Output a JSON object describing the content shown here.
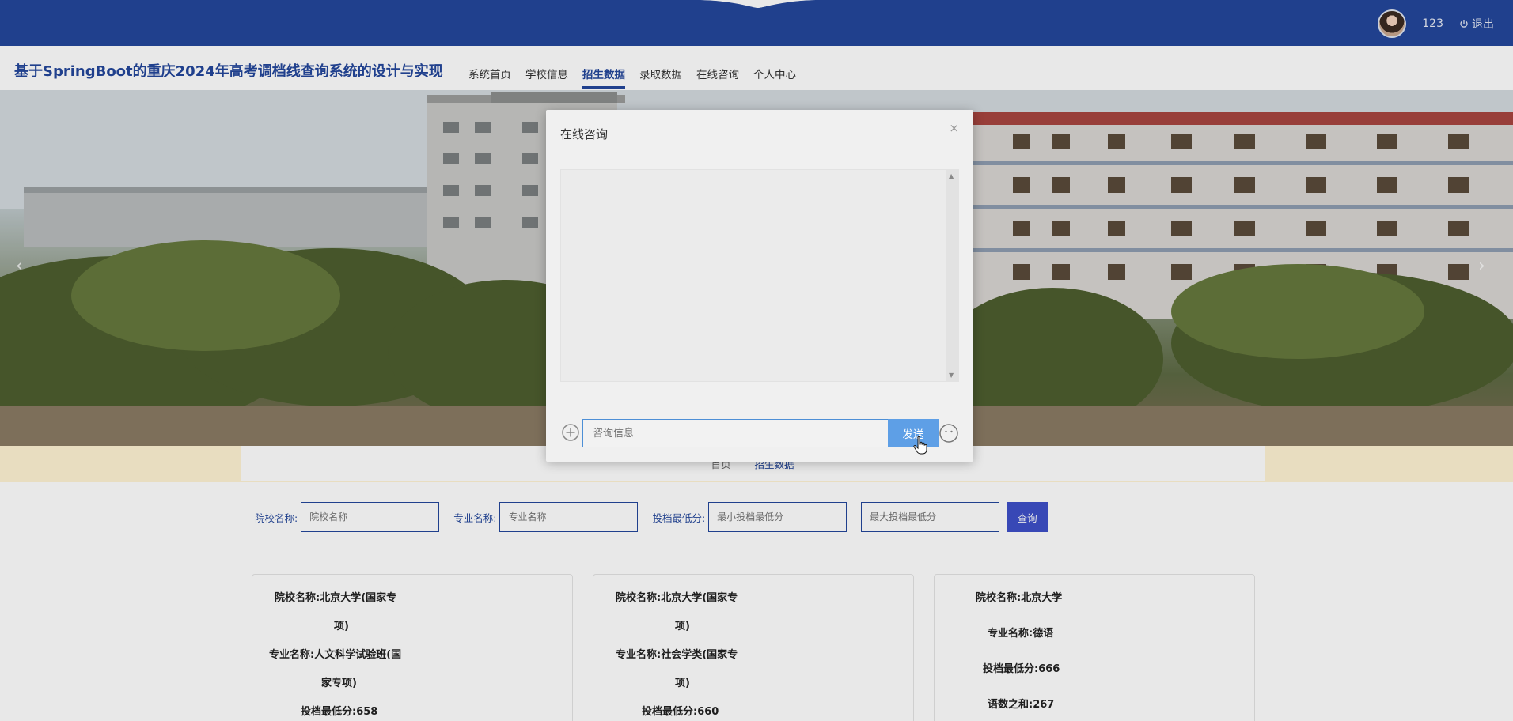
{
  "topbar": {
    "username": "123",
    "logout_label": "退出"
  },
  "header": {
    "site_title": "基于SpringBoot的重庆2024年高考调档线查询系统的设计与实现",
    "nav": [
      {
        "label": "系统首页",
        "active": false
      },
      {
        "label": "学校信息",
        "active": false
      },
      {
        "label": "招生数据",
        "active": true
      },
      {
        "label": "录取数据",
        "active": false
      },
      {
        "label": "在线咨询",
        "active": false
      },
      {
        "label": "个人中心",
        "active": false
      }
    ]
  },
  "breadcrumb": {
    "home": "首页",
    "current": "招生数据"
  },
  "search": {
    "school_label": "院校名称:",
    "school_placeholder": "院校名称",
    "major_label": "专业名称:",
    "major_placeholder": "专业名称",
    "score_label": "投档最低分:",
    "min_placeholder": "最小投档最低分",
    "max_placeholder": "最大投档最低分",
    "button": "查询"
  },
  "cards": [
    {
      "lines": [
        "院校名称:北京大学(国家专",
        "项)",
        "专业名称:人文科学试验班(国",
        "家专项)",
        "投档最低分:658"
      ]
    },
    {
      "lines": [
        "院校名称:北京大学(国家专",
        "项)",
        "专业名称:社会学类(国家专",
        "项)",
        "投档最低分:660"
      ]
    },
    {
      "lines": [
        "院校名称:北京大学",
        "专业名称:德语",
        "投档最低分:666",
        "语数之和:267"
      ]
    }
  ],
  "modal": {
    "title": "在线咨询",
    "close": "×",
    "input_placeholder": "咨询信息",
    "send_label": "发送"
  },
  "colors": {
    "brand": "#24479b",
    "send_button": "#5e9fe6",
    "search_button": "#3e50c9"
  },
  "icons": [
    "power-icon",
    "plus-circle-icon",
    "emoji-icon",
    "close-icon",
    "chevron-left-icon",
    "chevron-right-icon",
    "hand-cursor-icon"
  ]
}
